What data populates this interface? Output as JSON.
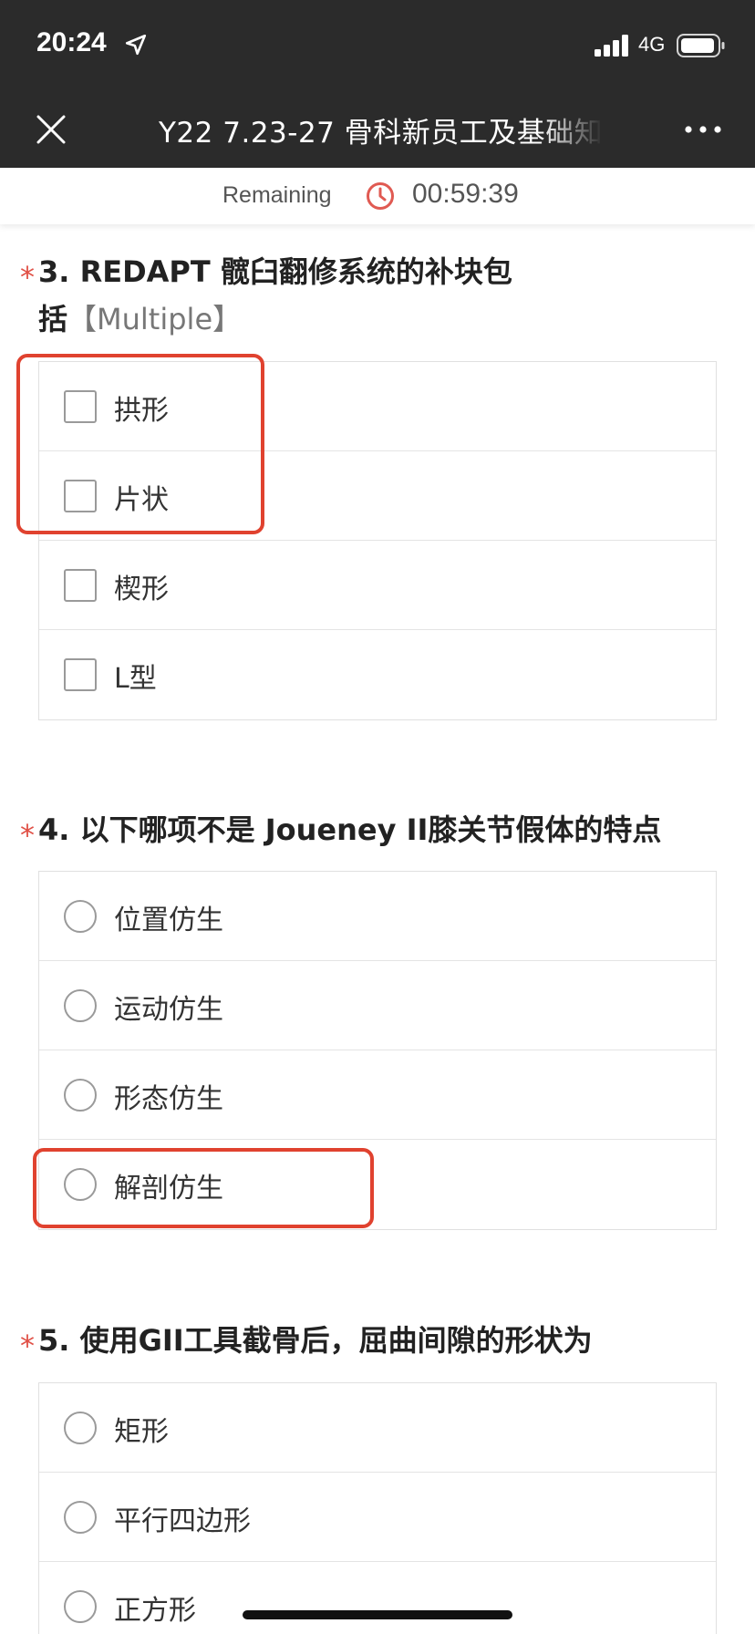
{
  "status_bar": {
    "time": "20:24",
    "network": "4G"
  },
  "nav": {
    "title": "Y22 7.23-27 骨科新员工及基础知"
  },
  "timer": {
    "label": "Remaining",
    "value": "00:59:39"
  },
  "questions": [
    {
      "required_mark": "*",
      "text": "3. REDAPT 髋臼翻修系统的补块包括",
      "text_line1": "3. REDAPT 髋臼翻修系统的补块包",
      "text_line2": "括",
      "tag": "【Multiple】",
      "type": "checkbox",
      "options": [
        "拱形",
        "片状",
        "楔形",
        "L型"
      ]
    },
    {
      "required_mark": "*",
      "text": "4. 以下哪项不是 Joueney II膝关节假体的特点",
      "type": "radio",
      "options": [
        "位置仿生",
        "运动仿生",
        "形态仿生",
        "解剖仿生"
      ]
    },
    {
      "required_mark": "*",
      "text": "5. 使用GII工具截骨后，屈曲间隙的形状为",
      "type": "radio",
      "options": [
        "矩形",
        "平行四边形",
        "正方形"
      ]
    }
  ],
  "colors": {
    "header_bg": "#2b2b2b",
    "required": "#e05046",
    "highlight": "#e0422f"
  }
}
